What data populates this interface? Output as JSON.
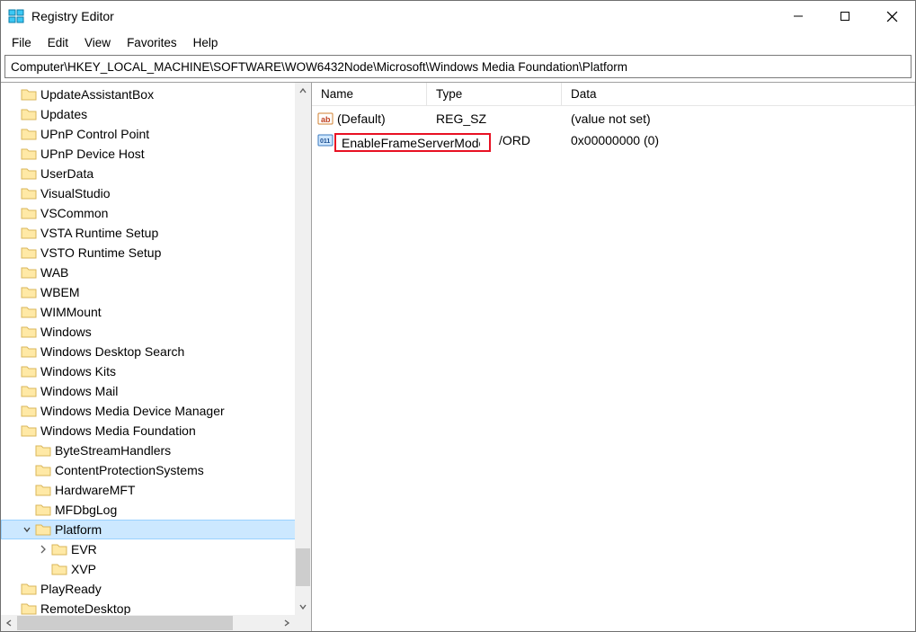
{
  "window": {
    "title": "Registry Editor"
  },
  "menu": {
    "file": "File",
    "edit": "Edit",
    "view": "View",
    "favorites": "Favorites",
    "help": "Help"
  },
  "address": "Computer\\HKEY_LOCAL_MACHINE\\SOFTWARE\\WOW6432Node\\Microsoft\\Windows Media Foundation\\Platform",
  "columns": {
    "name": "Name",
    "type": "Type",
    "data": "Data"
  },
  "tree": [
    {
      "label": "UpdateAssistantBox",
      "depth": 0
    },
    {
      "label": "Updates",
      "depth": 0
    },
    {
      "label": "UPnP Control Point",
      "depth": 0
    },
    {
      "label": "UPnP Device Host",
      "depth": 0
    },
    {
      "label": "UserData",
      "depth": 0
    },
    {
      "label": "VisualStudio",
      "depth": 0
    },
    {
      "label": "VSCommon",
      "depth": 0
    },
    {
      "label": "VSTA Runtime Setup",
      "depth": 0
    },
    {
      "label": "VSTO Runtime Setup",
      "depth": 0
    },
    {
      "label": "WAB",
      "depth": 0
    },
    {
      "label": "WBEM",
      "depth": 0
    },
    {
      "label": "WIMMount",
      "depth": 0
    },
    {
      "label": "Windows",
      "depth": 0
    },
    {
      "label": "Windows Desktop Search",
      "depth": 0
    },
    {
      "label": "Windows Kits",
      "depth": 0
    },
    {
      "label": "Windows Mail",
      "depth": 0
    },
    {
      "label": "Windows Media Device Manager",
      "depth": 0
    },
    {
      "label": "Windows Media Foundation",
      "depth": 0
    },
    {
      "label": "ByteStreamHandlers",
      "depth": 1
    },
    {
      "label": "ContentProtectionSystems",
      "depth": 1
    },
    {
      "label": "HardwareMFT",
      "depth": 1
    },
    {
      "label": "MFDbgLog",
      "depth": 1
    },
    {
      "label": "Platform",
      "depth": 1,
      "selected": true,
      "expanded": true
    },
    {
      "label": "EVR",
      "depth": 2,
      "twisty": true
    },
    {
      "label": "XVP",
      "depth": 2
    },
    {
      "label": "PlayReady",
      "depth": 0
    },
    {
      "label": "RemoteDesktop",
      "depth": 0
    }
  ],
  "values": [
    {
      "name": "(Default)",
      "type": "REG_SZ",
      "data": "(value not set)",
      "icon": "sz"
    },
    {
      "name": "EnableFrameServerMode",
      "type": "/ORD",
      "data": "0x00000000 (0)",
      "icon": "dword",
      "editing": true
    }
  ]
}
